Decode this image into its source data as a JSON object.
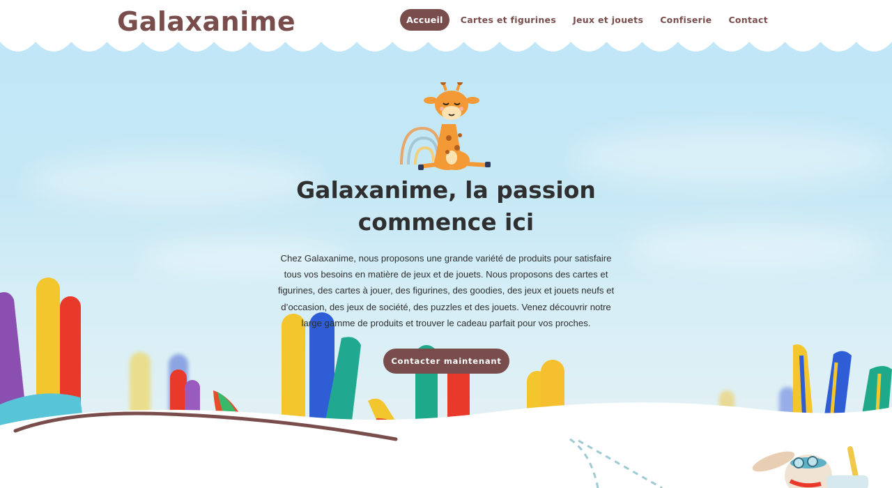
{
  "brand": {
    "logo_text": "Galaxanime"
  },
  "nav": {
    "items": [
      {
        "label": "Accueil",
        "active": true
      },
      {
        "label": "Cartes et figurines",
        "active": false
      },
      {
        "label": "Jeux et jouets",
        "active": false
      },
      {
        "label": "Confiserie",
        "active": false
      },
      {
        "label": "Contact",
        "active": false
      }
    ]
  },
  "hero": {
    "title_line1": "Galaxanime, la passion",
    "title_line2": "commence ici",
    "description": "Chez Galaxanime, nous proposons une grande variété de produits pour satisfaire tous vos besoins en matière de jeux et de jouets. Nous proposons des cartes et figurines, des cartes à jouer, des figurines, des goodies, des jeux et jouets neufs et d’occasion, des jeux de société, des puzzles et des jouets. Venez découvrir notre large gamme de produits et trouver le cadeau parfait pour vos proches.",
    "cta_label": "Contacter maintenant"
  },
  "colors": {
    "brand_brown": "#7a4d4d",
    "text_dark": "#2f2f2f",
    "sky": "#bfe6f7"
  },
  "icons": [
    "giraffe-illustration",
    "painted-hands-illustration",
    "rabbit-aviator-illustration",
    "paper-plane-trail"
  ]
}
